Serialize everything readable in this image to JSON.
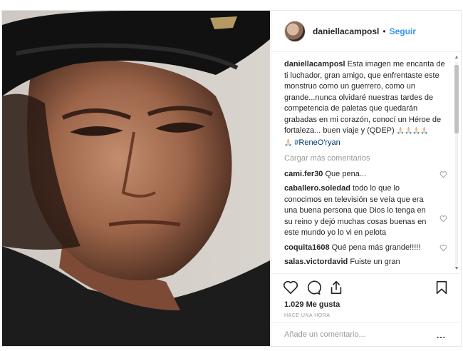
{
  "post": {
    "username": "daniellacamposl",
    "separator": "•",
    "follow_label": "Seguir",
    "caption_user": "daniellacamposl",
    "caption_text": "Esta imagen me encanta de ti luchador, gran amigo, que enfrentaste este monstruo como un guerrero, como un grande...nunca olvidaré nuestras tardes de competencia de paletas que quedarán grabadas en mi corazón, conocí un Héroe de fortaleza... buen viaje y (QDEP)",
    "caption_emojis": "🙏🏻🙏🏻🙏🏻🙏🏻",
    "caption_emoji_lead": "🙏🏻",
    "caption_hashtag": "#ReneO'ryan",
    "load_more": "Cargar más comentarios",
    "comments": [
      {
        "user": "cami.fer30",
        "text": "Que pena..."
      },
      {
        "user": "caballero.soledad",
        "text": "todo lo que lo conocimos en televisión se veía que era una buena persona que Dios lo tenga en su reino y dejó muchas cosas buenas en este mundo yo lo vi en pelota"
      },
      {
        "user": "coquita1608",
        "text": "Qué pena más grande!!!!!"
      },
      {
        "user": "salas.victordavid",
        "text": "Fuiste un gran"
      }
    ],
    "likes": "1.029 Me gusta",
    "timestamp": "HACE UNA HORA",
    "comment_placeholder": "Añade un comentario...",
    "options_label": "..."
  },
  "icons": {
    "like": "heart-icon",
    "comment": "comment-bubble-icon",
    "share": "share-icon",
    "save": "bookmark-icon"
  },
  "colors": {
    "link_blue": "#3897f0",
    "hashtag": "#003569",
    "muted": "#999999",
    "text": "#262626"
  }
}
